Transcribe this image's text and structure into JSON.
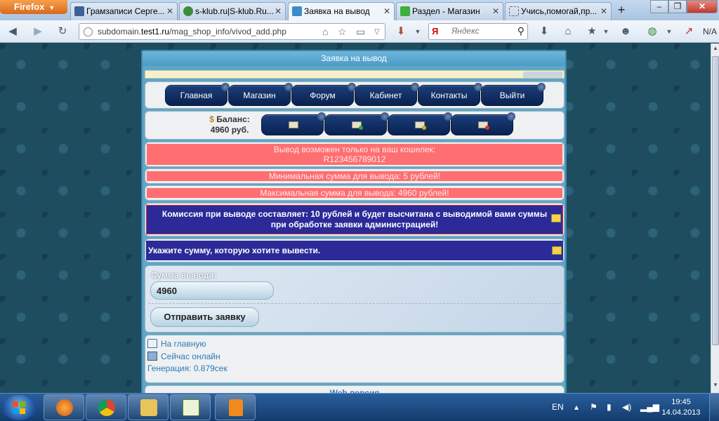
{
  "browser": {
    "menu_label": "Firefox",
    "tabs": [
      {
        "title": "Грамзаписи Серге..."
      },
      {
        "title": "s-klub.ru|S-klub.Ru..."
      },
      {
        "title": "Заявка на вывод"
      },
      {
        "title": "Раздел - Магазин"
      },
      {
        "title": "Учись,помогай,пр..."
      }
    ],
    "url_prefix": "subdomain.",
    "url_domain": "test1.ru",
    "url_path": "/mag_shop_info/vivod_add.php",
    "search_engine": "Я",
    "search_placeholder": "Яндекс",
    "toolbar_status": "N/A"
  },
  "page": {
    "header_title": "Заявка на вывод",
    "nav": [
      "Главная",
      "Магазин",
      "Форум",
      "Кабинет",
      "Контакты",
      "Выйти"
    ],
    "balance_label": "Баланс:",
    "balance_value": "4960 руб.",
    "wallet_line1": "Вывод возможен только на ваш кошелек:",
    "wallet_line2": "R123456789012",
    "min_sum": "Минимальная сумма для вывода: 5 рублей!",
    "max_sum": "Максимальная сумма для вывода: 4960 рублей!",
    "commission": "Комиссия при выводе составляет: 10 рублей и будет высчитана с выводимой вами суммы при обработке заявки администрацией!",
    "instruction": "Укажите сумму, которую хотите вывести.",
    "sum_label": "Сумма вывода:",
    "sum_value": "4960",
    "submit_label": "Отправить заявку",
    "footer_home": "На главную",
    "footer_online": "Сейчас онлайн",
    "generation": "Генерация: 0.879сек",
    "web_version": "Web версия"
  },
  "taskbar": {
    "language": "EN",
    "time": "19:45",
    "date": "14.04.2013"
  },
  "colors": {
    "header_blue": "#4b9cc6",
    "nav_button": "#0a2250",
    "alert_red": "#ff6f71",
    "info_purple": "#2b2a98",
    "link_blue": "#2d7ab7"
  }
}
